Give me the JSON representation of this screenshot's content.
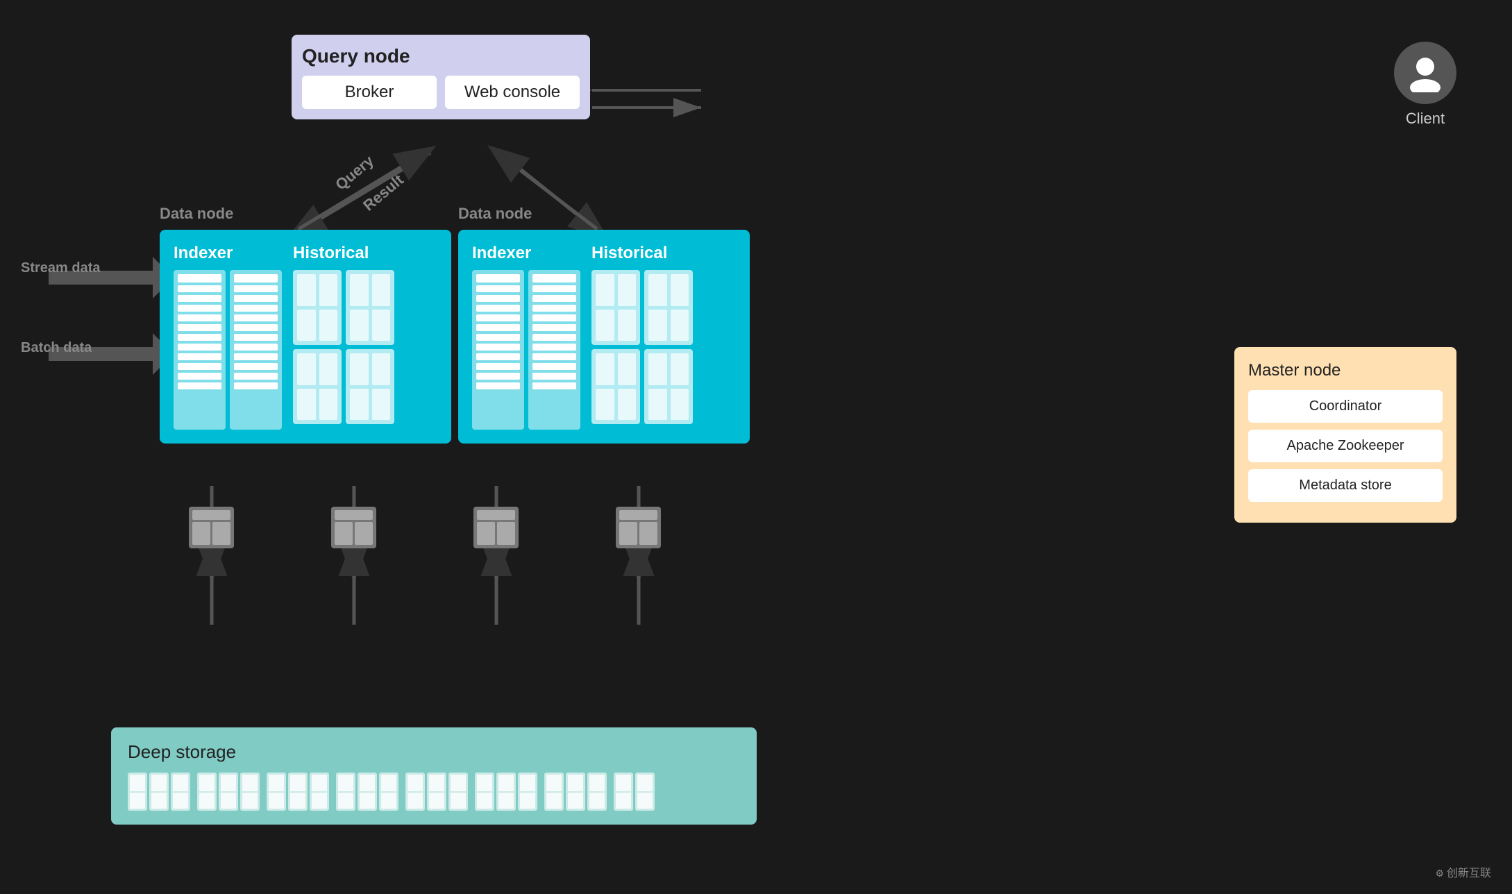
{
  "query_node": {
    "title": "Query node",
    "broker_label": "Broker",
    "web_console_label": "Web console"
  },
  "client": {
    "label": "Client"
  },
  "data_node_left": {
    "label": "Data node",
    "indexer_label": "Indexer",
    "historical_label": "Historical"
  },
  "data_node_right": {
    "label": "Data node",
    "indexer_label": "Indexer",
    "historical_label": "Historical"
  },
  "stream_data": {
    "label": "Stream data"
  },
  "batch_data": {
    "label": "Batch data"
  },
  "query_label": "Query",
  "result_label": "Result",
  "deep_storage": {
    "title": "Deep storage"
  },
  "master_node": {
    "title": "Master node",
    "coordinator_label": "Coordinator",
    "zookeeper_label": "Apache Zookeeper",
    "metadata_label": "Metadata store"
  },
  "watermark": "创新互联",
  "colors": {
    "query_node_bg": "#d0cfee",
    "data_node_bg": "#00bcd4",
    "deep_storage_bg": "#80cbc4",
    "master_node_bg": "#ffe0b2",
    "client_icon_bg": "#555555"
  }
}
